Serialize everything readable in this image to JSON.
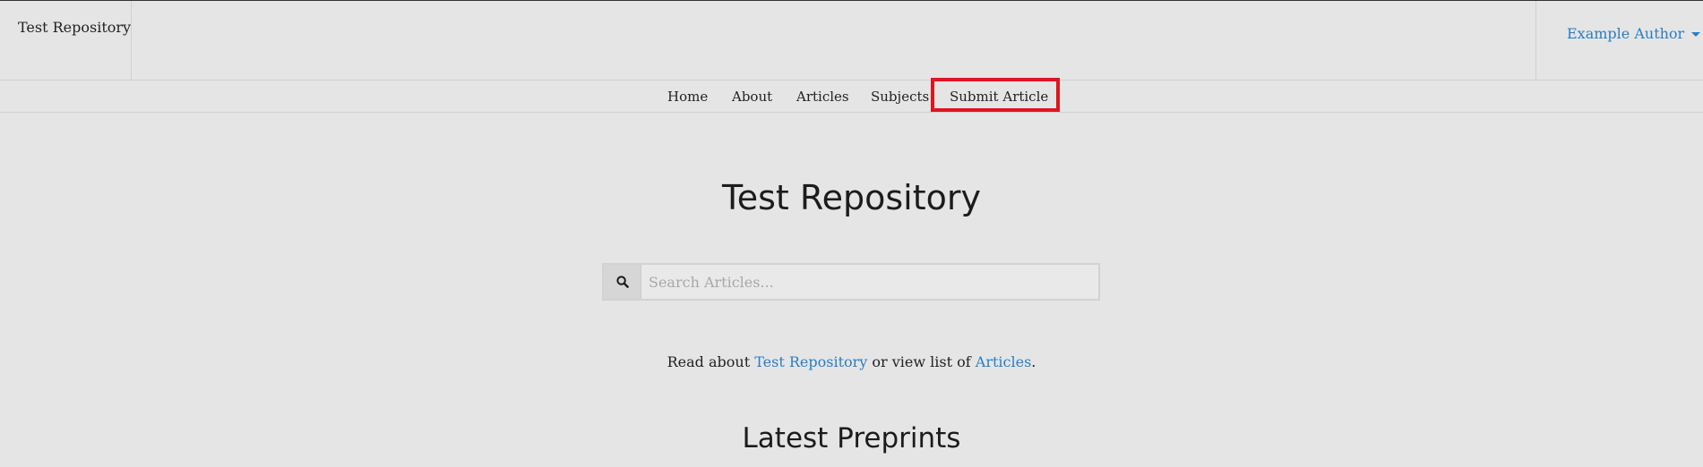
{
  "header": {
    "brand": "Test Repository",
    "account_name": "Example Author"
  },
  "nav": {
    "items": [
      {
        "label": "Home"
      },
      {
        "label": "About"
      },
      {
        "label": "Articles"
      },
      {
        "label": "Subjects"
      },
      {
        "label": "Submit Article"
      }
    ],
    "highlighted": "Submit Article",
    "highlight_color": "#e0151d"
  },
  "main": {
    "title": "Test Repository",
    "search": {
      "icon": "search-icon",
      "placeholder": "Search Articles..."
    },
    "intro": {
      "prefix": "Read about ",
      "repo_link": "Test Repository",
      "middle": " or view list of ",
      "articles_link": "Articles",
      "suffix": "."
    },
    "latest_title": "Latest Preprints"
  },
  "colors": {
    "link": "#2a7ec2",
    "background": "#e5e5e5"
  }
}
